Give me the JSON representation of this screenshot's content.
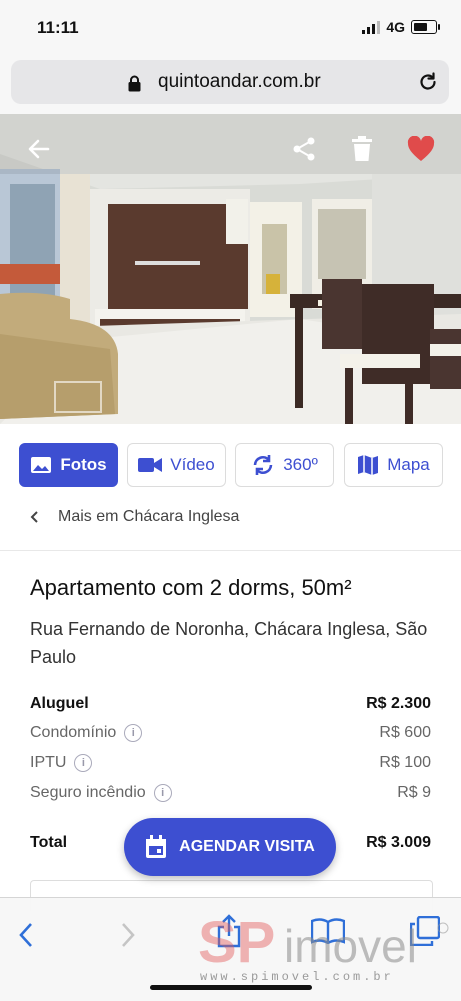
{
  "status_bar": {
    "time": "11:11",
    "network": "4G"
  },
  "url_bar": {
    "domain": "quintoandar.com.br"
  },
  "icons": {
    "back": "arrow-left-icon",
    "share": "share-icon",
    "delete": "trash-icon",
    "favorite": "heart-icon",
    "photos": "image-icon",
    "video": "video-camera-icon",
    "tour": "rotate-360-icon",
    "map": "map-icon",
    "calendar": "calendar-icon",
    "lock": "lock-icon",
    "reload": "reload-icon",
    "info": "info-icon"
  },
  "media_tabs": [
    {
      "label": "Fotos",
      "active": true
    },
    {
      "label": "Vídeo",
      "active": false
    },
    {
      "label": "360º",
      "active": false
    },
    {
      "label": "Mapa",
      "active": false
    }
  ],
  "breadcrumb": {
    "label": "Mais em Chácara Inglesa"
  },
  "listing": {
    "title": "Apartamento com 2 dorms, 50m²",
    "address": "Rua Fernando de Noronha, Chácara Inglesa, São Paulo"
  },
  "prices": {
    "rent": {
      "label": "Aluguel",
      "value": "R$ 2.300"
    },
    "condo": {
      "label": "Condomínio",
      "value": "R$ 600"
    },
    "iptu": {
      "label": "IPTU",
      "value": "R$ 100"
    },
    "insurance": {
      "label": "Seguro incêndio",
      "value": "R$ 9"
    },
    "total": {
      "label": "Total",
      "value": "R$ 3.009"
    }
  },
  "cta": {
    "label": "AGENDAR VISITA"
  },
  "watermark": {
    "brand": "SPimovel",
    "url": "www.spimovel.com.br"
  },
  "colors": {
    "accent": "#3d4fd1",
    "favorite": "#e04b4b"
  }
}
